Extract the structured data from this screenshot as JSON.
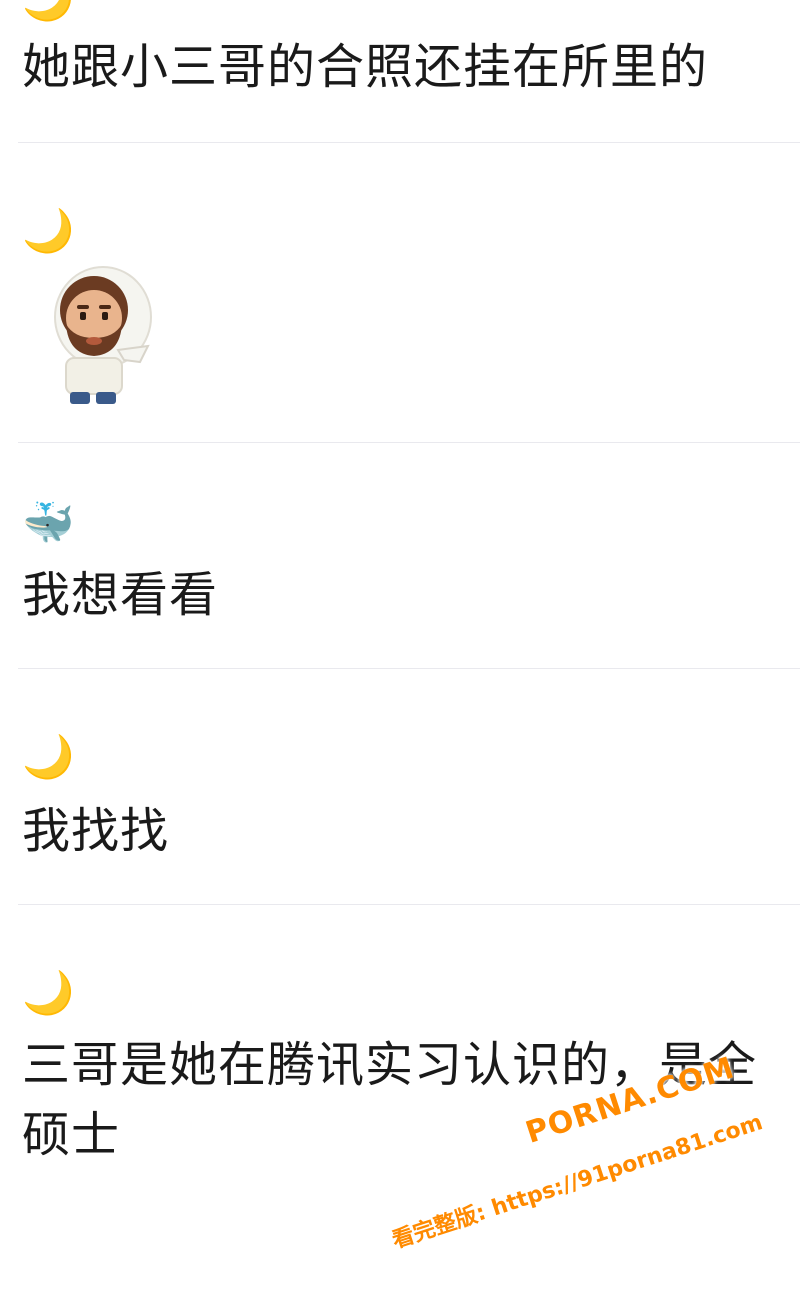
{
  "messages": [
    {
      "avatar_icon": "crescent-moon-icon",
      "avatar_glyph": "🌙",
      "text": "她跟小三哥的合照还挂在所里的"
    },
    {
      "avatar_icon": "crescent-moon-icon",
      "avatar_glyph": "🌙",
      "sticker": "bearded-man-sticker"
    },
    {
      "avatar_icon": "whale-icon",
      "avatar_glyph": "🐳",
      "text": "我想看看"
    },
    {
      "avatar_icon": "crescent-moon-icon",
      "avatar_glyph": "🌙",
      "text": "我找找"
    },
    {
      "avatar_icon": "crescent-moon-icon",
      "avatar_glyph": "🌙",
      "text": "三哥是她在腾讯实习认识的，是全硕士"
    }
  ],
  "watermark": {
    "domain": "PORNA.COM",
    "line": "看完整版: https://91porna81.com"
  },
  "colors": {
    "divider": "#e9e9ee",
    "watermark": "#ff8a00"
  }
}
